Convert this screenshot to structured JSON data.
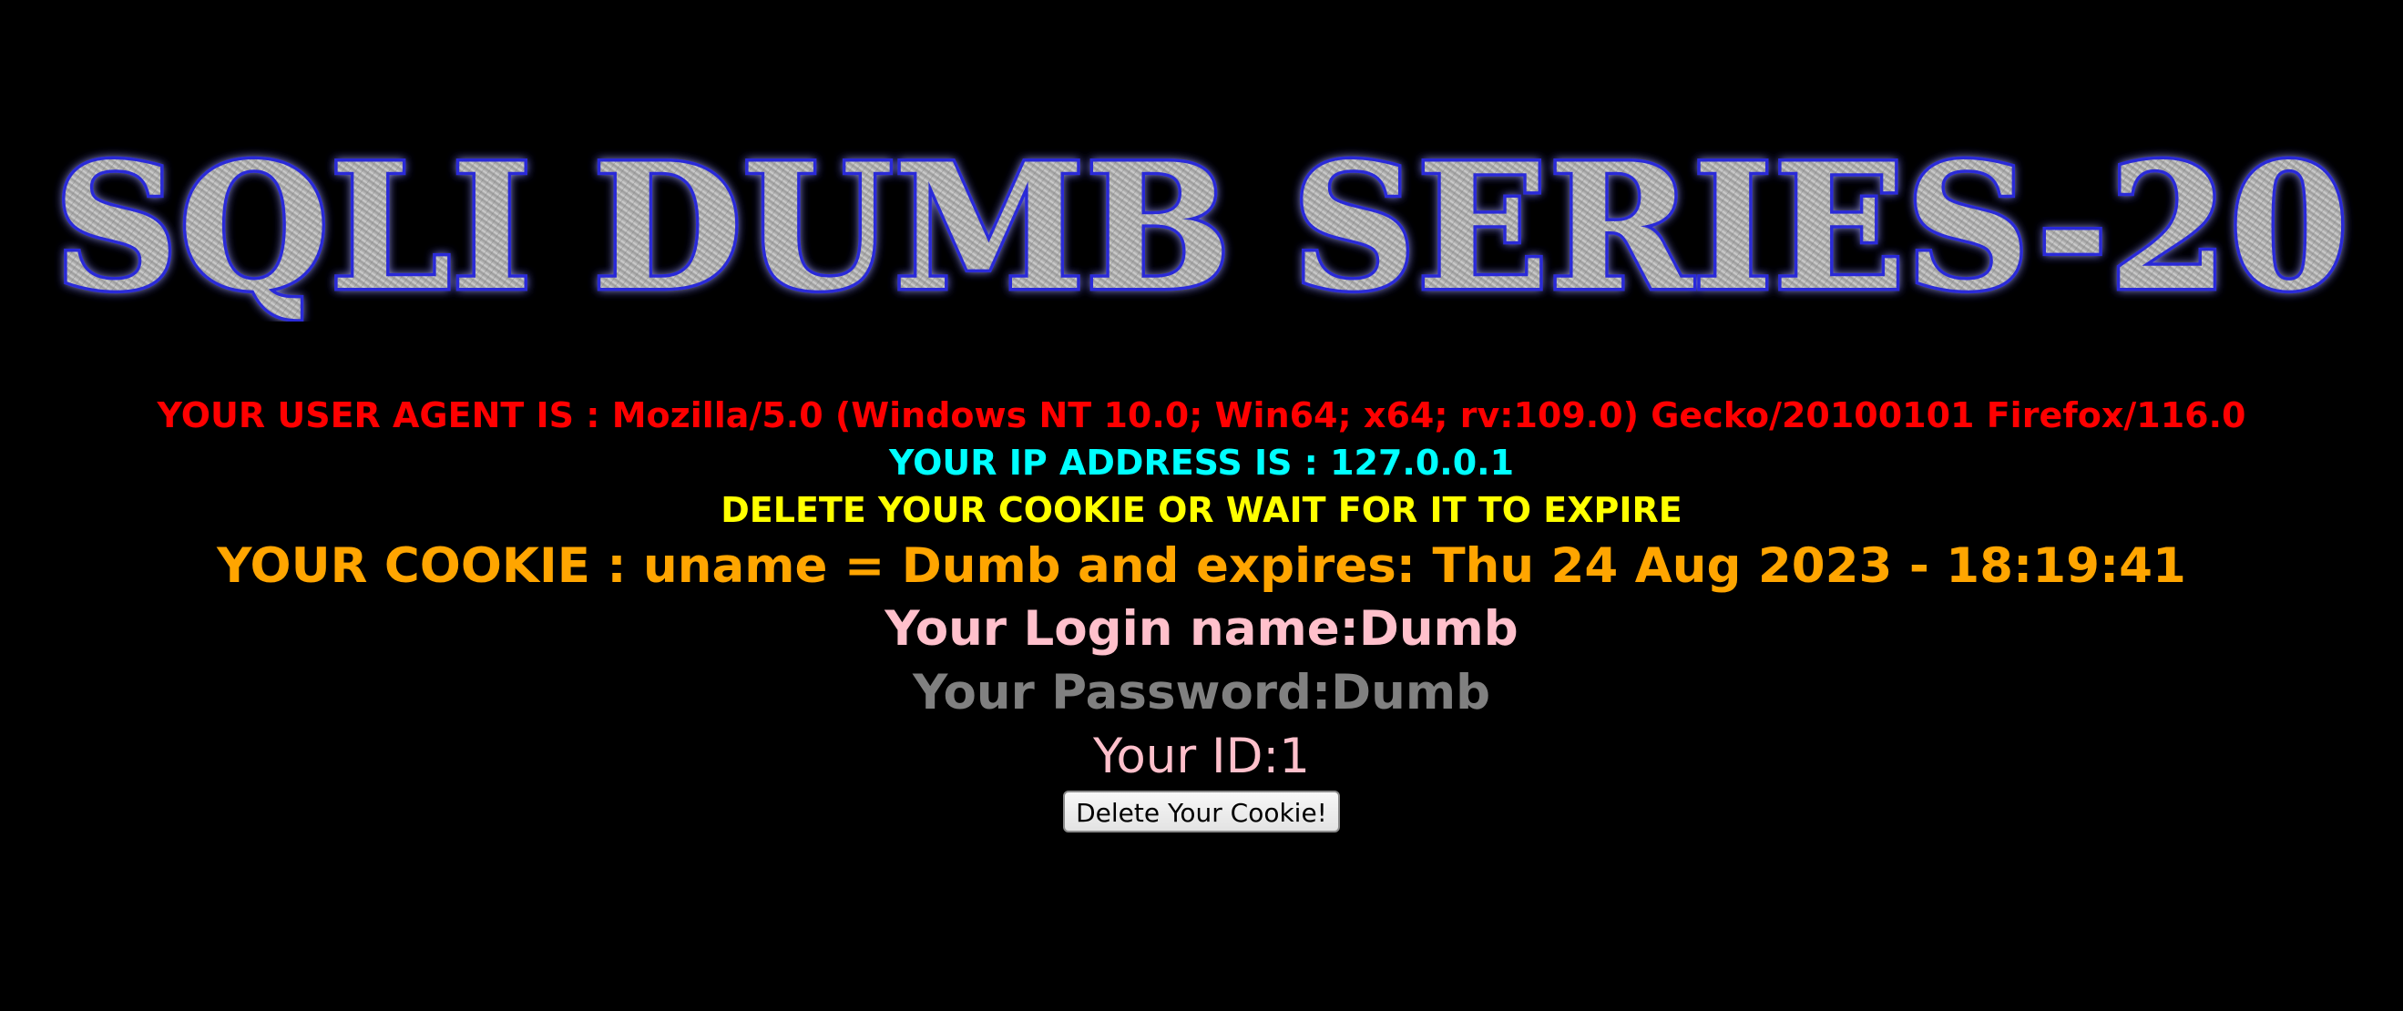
{
  "banner": {
    "title": "SQLI DUMB SERIES-20"
  },
  "info": {
    "user_agent": "YOUR USER AGENT IS : Mozilla/5.0 (Windows NT 10.0; Win64; x64; rv:109.0) Gecko/20100101 Firefox/116.0",
    "ip_address": "YOUR IP ADDRESS IS : 127.0.0.1",
    "delete_notice": "DELETE YOUR COOKIE OR WAIT FOR IT TO EXPIRE",
    "cookie": "YOUR COOKIE : uname = Dumb and expires: Thu 24 Aug 2023 - 18:19:41",
    "login_name": "Your Login name:Dumb",
    "password": "Your Password:Dumb",
    "id": "Your ID:1"
  },
  "actions": {
    "delete_cookie_label": "Delete Your Cookie!"
  },
  "colors": {
    "background": "#000000",
    "user_agent": "#ff0000",
    "ip_address": "#00ffff",
    "delete_notice": "#ffff00",
    "cookie": "#ffa500",
    "login_name": "#ffc0cb",
    "password": "#808080",
    "id": "#ffc0cb",
    "banner_fill": "#a8a8a8",
    "banner_glow": "#2a2ad8"
  }
}
